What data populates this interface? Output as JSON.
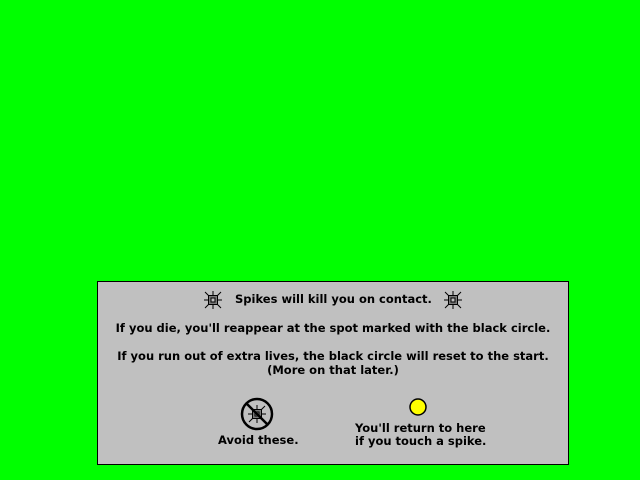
{
  "colors": {
    "background": "#00ff00",
    "panel": "#c0c0c0",
    "checkpoint": "#ffff00"
  },
  "tutorial": {
    "spike_warning": "Spikes will kill you on contact.",
    "respawn_line": "If you die, you'll reappear at the spot marked with the black circle.",
    "reset_line_1": "If you run out of extra lives, the black circle will reset to the start.",
    "reset_line_2": "(More on that later.)",
    "avoid_caption": "Avoid these.",
    "checkpoint_caption_1": "You'll return to here",
    "checkpoint_caption_2": "if you touch a spike."
  },
  "icons": {
    "spike": "spike-icon",
    "prohibited_spike": "no-spike-icon",
    "checkpoint": "checkpoint-circle-icon"
  }
}
